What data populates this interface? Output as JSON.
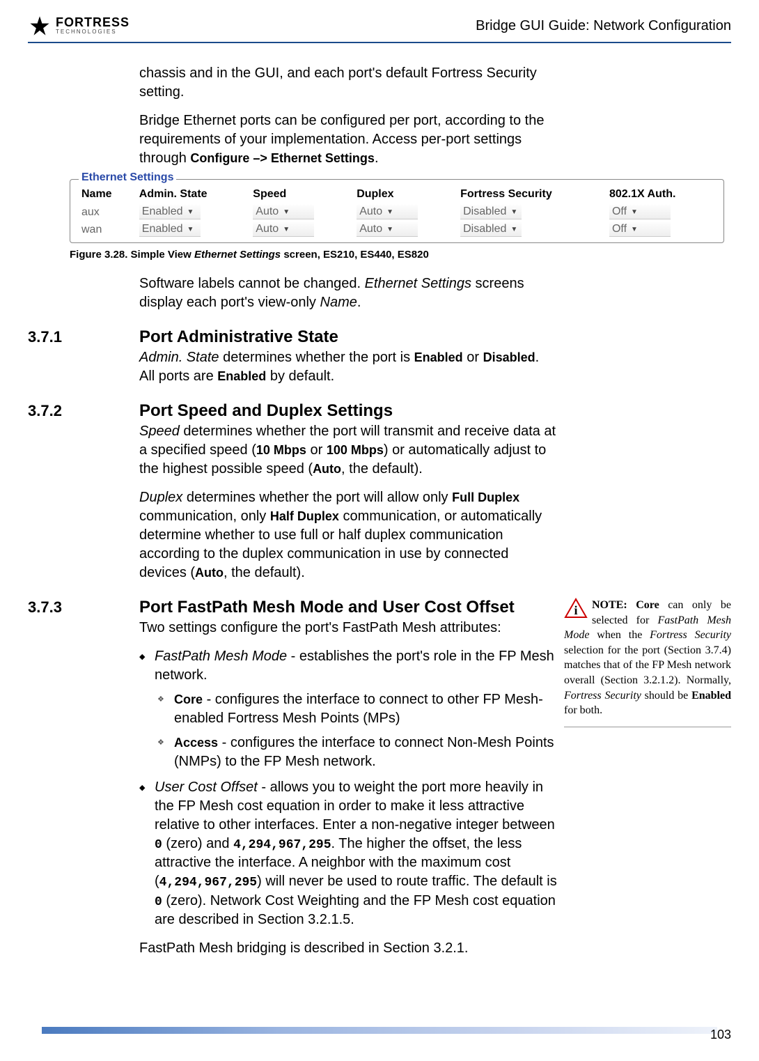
{
  "header": {
    "logo_main": "FORTRESS",
    "logo_sub": "TECHNOLOGIES",
    "doc_title": "Bridge GUI Guide: Network Configuration"
  },
  "intro": {
    "p1_a": "chassis and in the GUI, and each port's default Fortress Security setting.",
    "p2_a": "Bridge Ethernet ports can be configured per port, according to the requirements of your implementation. Access per-port settings through ",
    "p2_b": "Configure –> Ethernet Settings",
    "p2_c": "."
  },
  "screenshot": {
    "group_label": "Ethernet Settings",
    "headers": [
      "Name",
      "Admin. State",
      "Speed",
      "Duplex",
      "Fortress Security",
      "802.1X Auth."
    ],
    "rows": [
      {
        "name": "aux",
        "admin": "Enabled",
        "speed": "Auto",
        "duplex": "Auto",
        "sec": "Disabled",
        "auth": "Off"
      },
      {
        "name": "wan",
        "admin": "Enabled",
        "speed": "Auto",
        "duplex": "Auto",
        "sec": "Disabled",
        "auth": "Off"
      }
    ]
  },
  "fig_caption": {
    "a": "Figure 3.28. Simple View ",
    "b": "Ethernet Settings",
    "c": " screen, ES210, ES440, ES820"
  },
  "after_fig": {
    "a": "Software labels cannot be changed. ",
    "b": "Ethernet Settings",
    "c": " screens display each port's view-only ",
    "d": "Name",
    "e": "."
  },
  "s371": {
    "num": "3.7.1",
    "title": "Port Administrative State",
    "p_a": "Admin. State",
    "p_b": " determines whether the port is ",
    "p_c": "Enabled",
    "p_d": " or ",
    "p_e": "Disabled",
    "p_f": ". All ports are ",
    "p_g": "Enabled",
    "p_h": " by default."
  },
  "s372": {
    "num": "3.7.2",
    "title": "Port Speed and Duplex Settings",
    "p1_a": "Speed",
    "p1_b": " determines whether the port will transmit and receive data at a specified speed (",
    "p1_c": "10 Mbps",
    "p1_d": " or ",
    "p1_e": "100 Mbps",
    "p1_f": ") or automatically adjust to the highest possible speed (",
    "p1_g": "Auto",
    "p1_h": ", the default).",
    "p2_a": "Duplex",
    "p2_b": " determines whether the port will allow only ",
    "p2_c": "Full Duplex",
    "p2_d": " communication, only ",
    "p2_e": "Half Duplex",
    "p2_f": " communication, or automatically determine whether to use full or half duplex communication according to the duplex communication in use by connected devices (",
    "p2_g": "Auto",
    "p2_h": ", the default)."
  },
  "s373": {
    "num": "3.7.3",
    "title": "Port FastPath Mesh Mode and User Cost Offset",
    "intro": "Two settings configure the port's FastPath Mesh attributes:",
    "b1_a": "FastPath Mesh Mode",
    "b1_b": " - establishes the port's role in the FP Mesh network.",
    "b1s1_a": "Core",
    "b1s1_b": " - configures the interface to connect to other FP Mesh-enabled Fortress Mesh Points (MPs)",
    "b1s2_a": "Access",
    "b1s2_b": " - configures the interface to connect Non-Mesh Points (NMPs) to the FP Mesh network.",
    "b2_a": "User Cost Offset",
    "b2_b": " - allows you to weight the port more heavily in the FP Mesh cost equation in order to make it less attractive relative to other interfaces. Enter a non-negative integer between ",
    "b2_c": "0",
    "b2_d": " (zero) and ",
    "b2_e": "4,294,967,295",
    "b2_f": ". The higher the offset, the less attractive the interface. A neighbor with the maximum cost (",
    "b2_g": "4,294,967,295",
    "b2_h": ") will never be used to route traffic. The default is ",
    "b2_i": "0",
    "b2_j": " (zero). Network Cost Weighting and the FP Mesh cost equation are described in Section 3.2.1.5.",
    "outro": "FastPath Mesh bridging is described in Section 3.2.1."
  },
  "note": {
    "a": "NOTE: Core",
    "b": " can only be selected for ",
    "c": "FastPath Mesh Mode",
    "d": " when the ",
    "e": "Fortress Security",
    "f": " selection for the port (Section 3.7.4) matches that of the FP Mesh network overall (Section 3.2.1.2). Normally, ",
    "g": "Fortress Security",
    "h": " should be ",
    "i": "Enabled",
    "j": " for both."
  },
  "page_number": "103"
}
